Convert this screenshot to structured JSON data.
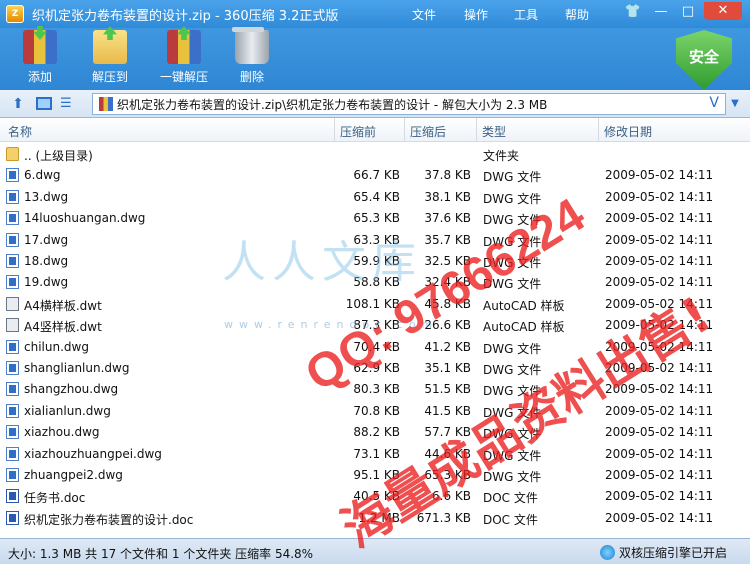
{
  "window": {
    "title": "织机定张力卷布装置的设计.zip - 360压缩 3.2正式版",
    "menu": [
      "文件",
      "操作",
      "工具",
      "帮助"
    ],
    "controls": {
      "skin": "👕",
      "minimize": "—",
      "maximize": "□",
      "close": "✕"
    }
  },
  "toolbar": {
    "add_label": "添加",
    "extract_label": "解压到",
    "oneclick_label": "一键解压",
    "delete_label": "删除",
    "security_label": "安全"
  },
  "addressbar": {
    "path": "织机定张力卷布装置的设计.zip\\织机定张力卷布装置的设计 - 解包大小为 2.3 MB",
    "v_label": "V"
  },
  "columns": {
    "name": "名称",
    "before": "压缩前",
    "after": "压缩后",
    "type": "类型",
    "date": "修改日期"
  },
  "files": [
    {
      "icon": "folder-icon",
      "name": ".. (上级目录)",
      "before": "",
      "after": "",
      "type": "文件夹",
      "date": ""
    },
    {
      "icon": "dwg-file-icon",
      "name": "6.dwg",
      "before": "66.7 KB",
      "after": "37.8 KB",
      "type": "DWG 文件",
      "date": "2009-05-02 14:11"
    },
    {
      "icon": "dwg-file-icon",
      "name": "13.dwg",
      "before": "65.4 KB",
      "after": "38.1 KB",
      "type": "DWG 文件",
      "date": "2009-05-02 14:11"
    },
    {
      "icon": "dwg-file-icon",
      "name": "14luoshuangan.dwg",
      "before": "65.3 KB",
      "after": "37.6 KB",
      "type": "DWG 文件",
      "date": "2009-05-02 14:11"
    },
    {
      "icon": "dwg-file-icon",
      "name": "17.dwg",
      "before": "63.3 KB",
      "after": "35.7 KB",
      "type": "DWG 文件",
      "date": "2009-05-02 14:11"
    },
    {
      "icon": "dwg-file-icon",
      "name": "18.dwg",
      "before": "59.9 KB",
      "after": "32.5 KB",
      "type": "DWG 文件",
      "date": "2009-05-02 14:11"
    },
    {
      "icon": "dwg-file-icon",
      "name": "19.dwg",
      "before": "58.8 KB",
      "after": "32.4 KB",
      "type": "DWG 文件",
      "date": "2009-05-02 14:11"
    },
    {
      "icon": "dwt-file-icon",
      "name": "A4横样板.dwt",
      "before": "108.1 KB",
      "after": "45.8 KB",
      "type": "AutoCAD 样板",
      "date": "2009-05-02 14:11"
    },
    {
      "icon": "dwt-file-icon",
      "name": "A4竖样板.dwt",
      "before": "87.3 KB",
      "after": "26.6 KB",
      "type": "AutoCAD 样板",
      "date": "2009-05-02 14:11"
    },
    {
      "icon": "dwg-file-icon",
      "name": "chilun.dwg",
      "before": "70.4 KB",
      "after": "41.2 KB",
      "type": "DWG 文件",
      "date": "2009-05-02 14:11"
    },
    {
      "icon": "dwg-file-icon",
      "name": "shanglianlun.dwg",
      "before": "62.9 KB",
      "after": "35.1 KB",
      "type": "DWG 文件",
      "date": "2009-05-02 14:11"
    },
    {
      "icon": "dwg-file-icon",
      "name": "shangzhou.dwg",
      "before": "80.3 KB",
      "after": "51.5 KB",
      "type": "DWG 文件",
      "date": "2009-05-02 14:11"
    },
    {
      "icon": "dwg-file-icon",
      "name": "xialianlun.dwg",
      "before": "70.8 KB",
      "after": "41.5 KB",
      "type": "DWG 文件",
      "date": "2009-05-02 14:11"
    },
    {
      "icon": "dwg-file-icon",
      "name": "xiazhou.dwg",
      "before": "88.2 KB",
      "after": "57.7 KB",
      "type": "DWG 文件",
      "date": "2009-05-02 14:11"
    },
    {
      "icon": "dwg-file-icon",
      "name": "xiazhouzhuangpei.dwg",
      "before": "73.1 KB",
      "after": "44.6 KB",
      "type": "DWG 文件",
      "date": "2009-05-02 14:11"
    },
    {
      "icon": "dwg-file-icon",
      "name": "zhuangpei2.dwg",
      "before": "95.1 KB",
      "after": "65.3 KB",
      "type": "DWG 文件",
      "date": "2009-05-02 14:11"
    },
    {
      "icon": "doc-file-icon",
      "name": "任务书.doc",
      "before": "40.5 KB",
      "after": "6.6 KB",
      "type": "DOC 文件",
      "date": "2009-05-02 14:11"
    },
    {
      "icon": "doc-file-icon",
      "name": "织机定张力卷布装置的设计.doc",
      "before": "1.2 MB",
      "after": "671.3 KB",
      "type": "DOC 文件",
      "date": "2009-05-02 14:11"
    }
  ],
  "status": {
    "text": "大小: 1.3 MB 共 17 个文件和 1 个文件夹 压缩率 54.8%",
    "engine": "双核压缩引擎已开启"
  },
  "watermarks": {
    "logo": "人人文库",
    "url": "www.renrendoc.com",
    "qq": "QQ: 97666224",
    "ad": "海量成品资料出售!"
  },
  "colors": {
    "title_blue": "#3a8fd6",
    "status_bg": "#d6e4f3",
    "watermark_red": "#eb1e1e",
    "security_green": "#2f9b2f"
  }
}
